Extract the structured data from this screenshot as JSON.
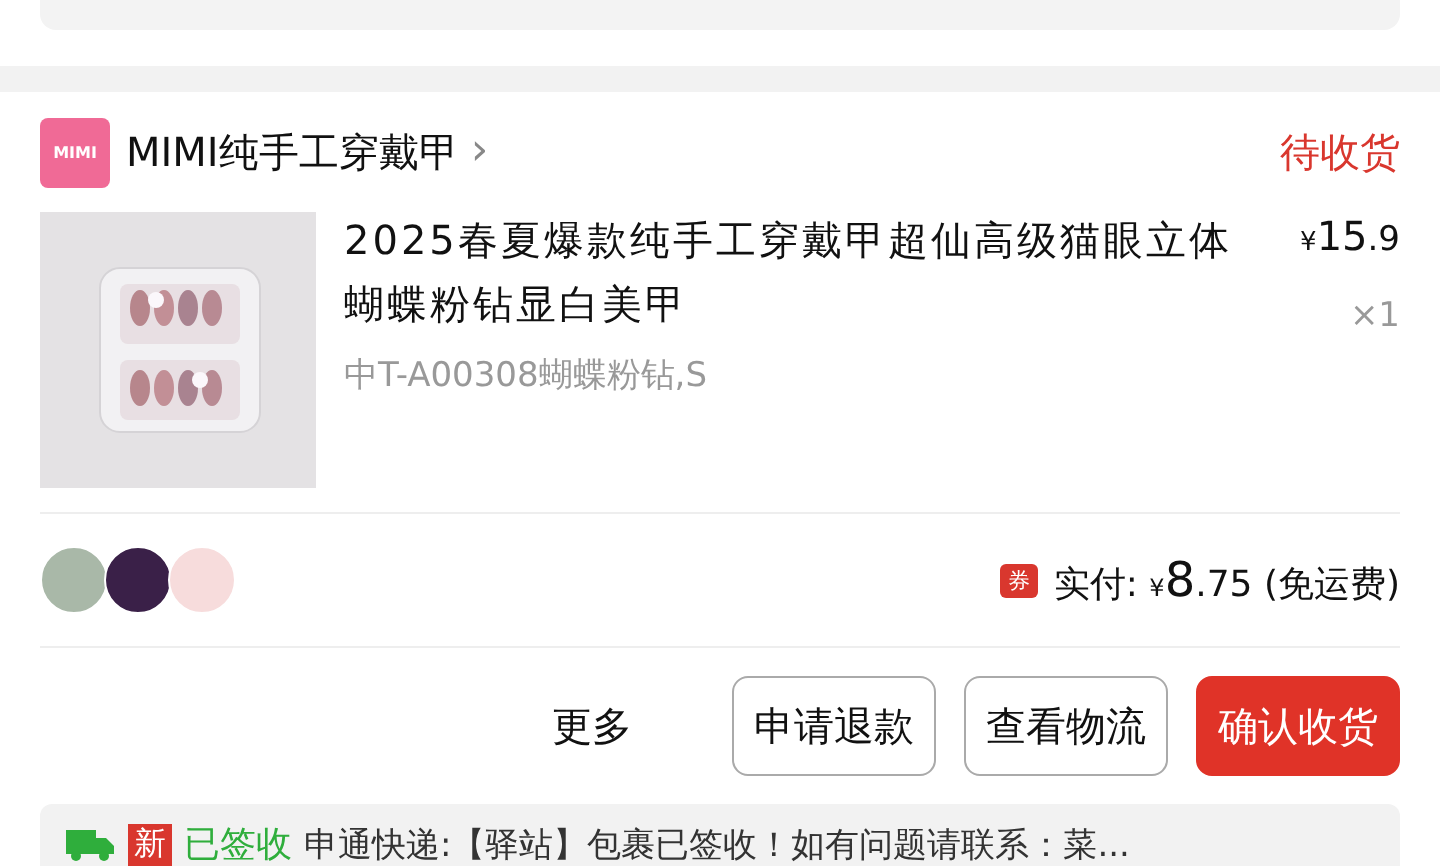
{
  "shop": {
    "logo": "MIMI",
    "name": "MIMI纯手工穿戴甲",
    "chevron": "›",
    "status": "待收货"
  },
  "product": {
    "title": "2025春夏爆款纯手工穿戴甲超仙高级猫眼立体蝴蝶粉钻显白美甲",
    "variant": "中T-A00308蝴蝶粉钻,S",
    "currency": "¥",
    "price_main": "15",
    "price_decimal": ".9",
    "quantity": "×1"
  },
  "payment": {
    "avatars": [
      {
        "color": "#a9b8a8"
      },
      {
        "color": "#3a2048"
      },
      {
        "color": "#f7dcdc"
      }
    ],
    "coupon_badge": "券",
    "label": "实付:",
    "currency": "¥",
    "amount_main": "8",
    "amount_decimal": ".75",
    "shipping_note": "(免运费)"
  },
  "actions": [
    {
      "label": "更多",
      "kind": "text"
    },
    {
      "label": "申请退款",
      "kind": "outline"
    },
    {
      "label": "查看物流",
      "kind": "outline"
    },
    {
      "label": "确认收货",
      "kind": "primary"
    }
  ],
  "logistics": {
    "new_badge": "新",
    "status": "已签收",
    "message": "申通快递:【驿站】包裹已签收！如有问题请联系：菜..."
  }
}
